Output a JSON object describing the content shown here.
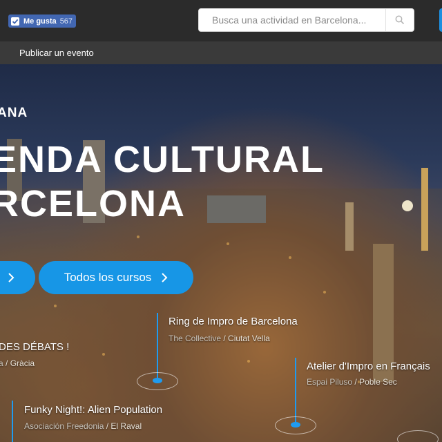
{
  "topbar": {
    "like_label": "Me gusta",
    "like_count": "567",
    "search_placeholder": "Busca una actividad en Barcelona...",
    "search_icon": "search-icon"
  },
  "subnav": {
    "publish_label": "Publicar un evento"
  },
  "hero": {
    "kicker": "ANA",
    "title_line1": "ENDA CULTURAL",
    "title_line2": "RCELONA",
    "courses_button": "Todos los cursos"
  },
  "events": [
    {
      "title": "Ring de Impro de Barcelona",
      "venue": "The Collective",
      "area": "Ciutat Vella"
    },
    {
      "title": "DES DÉBATS !",
      "venue": "a",
      "area": "Gràcia"
    },
    {
      "title": "Atelier d'Impro en Français",
      "venue": "Espai Piluso",
      "area": "Poble Sec"
    },
    {
      "title": "Funky Night!: Alien Population",
      "venue": "Asociación Freedonia",
      "area": "El Raval"
    }
  ],
  "colors": {
    "accent": "#1796e6",
    "facebook": "#4267b2",
    "topbar": "#2b2b2b",
    "subnav": "#3a3a3a"
  }
}
